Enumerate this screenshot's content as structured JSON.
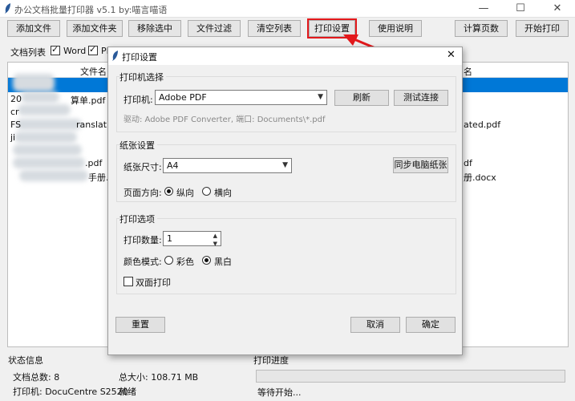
{
  "window": {
    "title": "办公文档批量打印器 v5.1 by:喵言喵语",
    "minimize": "—",
    "maximize": "☐",
    "close": "✕"
  },
  "toolbar": {
    "add_file": "添加文件",
    "add_folder": "添加文件夹",
    "remove_selected": "移除选中",
    "file_filter": "文件过滤",
    "clear_list": "清空列表",
    "print_settings": "打印设置",
    "instructions": "使用说明",
    "count_pages": "计算页数",
    "start_print": "开始打印"
  },
  "filelist": {
    "label": "文档列表",
    "filters": [
      {
        "label": "Word",
        "checked": true
      },
      {
        "label": "PI",
        "checked": true
      }
    ],
    "col_name": "文件名",
    "col_right": "名",
    "rows_left": [
      "20",
      "cr",
      "FS",
      "ji"
    ],
    "rows_left_tail": [
      "算单.pdf",
      "ranslat",
      ".pdf",
      "手册."
    ],
    "rows_right": [
      "ated.pdf",
      "df",
      "册.docx"
    ]
  },
  "status": {
    "section": "状态信息",
    "doc_count": "文档总数: 8",
    "total_size": "总大小: 108.71 MB",
    "printer": "打印机: DocuCentre S2520",
    "ready": "就绪",
    "progress_section": "打印进度",
    "progress_text": "等待开始...",
    "progress": 0
  },
  "dialog": {
    "title": "打印设置",
    "close": "✕",
    "printer_section": "打印机选择",
    "printer_label": "打印机:",
    "printer_value": "Adobe PDF",
    "refresh": "刷新",
    "test_connection": "测试连接",
    "driver_info": "驱动: Adobe PDF Converter, 端口: Documents\\*.pdf",
    "paper_section": "纸张设置",
    "paper_size_label": "纸张尺寸:",
    "paper_size_value": "A4",
    "sync_paper": "同步电脑纸张",
    "orientation_label": "页面方向:",
    "orientation_portrait": "纵向",
    "orientation_landscape": "横向",
    "orientation_selected": "portrait",
    "options_section": "打印选项",
    "copies_label": "打印数量:",
    "copies_value": "1",
    "color_label": "颜色模式:",
    "color_option": "彩色",
    "bw_option": "黑白",
    "color_selected": "bw",
    "duplex_label": "双面打印",
    "duplex_checked": false,
    "reset": "重置",
    "cancel": "取消",
    "ok": "确定"
  },
  "colors": {
    "accent": "#0078d7",
    "highlight": "#e3191c"
  }
}
